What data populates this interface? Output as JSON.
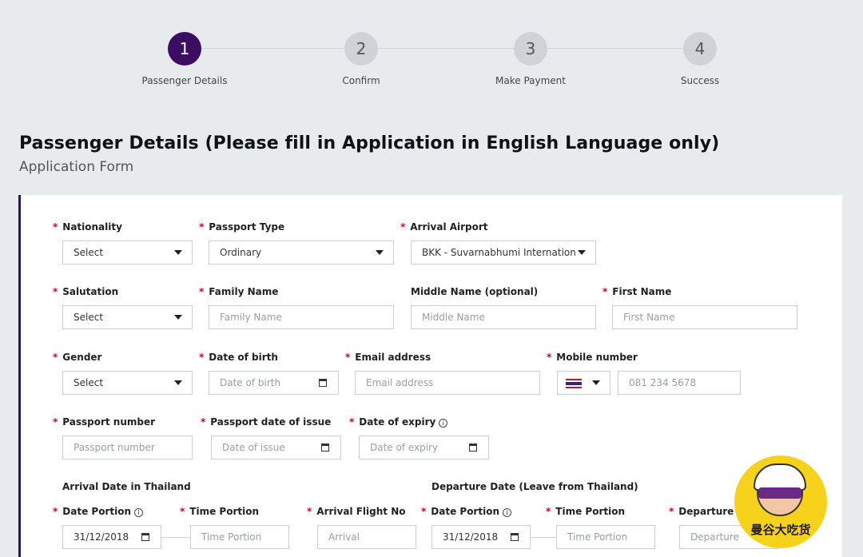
{
  "stepper": {
    "steps": [
      {
        "number": "1",
        "label": "Passenger Details"
      },
      {
        "number": "2",
        "label": "Confirm"
      },
      {
        "number": "3",
        "label": "Make Payment"
      },
      {
        "number": "4",
        "label": "Success"
      }
    ]
  },
  "header": {
    "title": "Passenger Details (Please fill in Application in English Language only)",
    "subtitle": "Application Form"
  },
  "form": {
    "required_mark": "*",
    "info_mark": "i",
    "nationality": {
      "label": "Nationality",
      "value": "Select"
    },
    "passport_type": {
      "label": "Passport Type",
      "value": "Ordinary"
    },
    "arrival_airport": {
      "label": "Arrival Airport",
      "value": "BKK - Suvarnabhumi Internation"
    },
    "salutation": {
      "label": "Salutation",
      "value": "Select"
    },
    "family_name": {
      "label": "Family Name",
      "placeholder": "Family Name"
    },
    "middle_name": {
      "label": "Middle Name (optional)",
      "placeholder": "Middle Name"
    },
    "first_name": {
      "label": "First Name",
      "placeholder": "First Name"
    },
    "gender": {
      "label": "Gender",
      "value": "Select"
    },
    "date_of_birth": {
      "label": "Date of birth",
      "placeholder": "Date of birth"
    },
    "email": {
      "label": "Email address",
      "placeholder": "Email address"
    },
    "mobile": {
      "label": "Mobile number",
      "placeholder": "081 234 5678",
      "country_flag": "thailand-flag"
    },
    "passport_number": {
      "label": "Passport number",
      "placeholder": "Passport number"
    },
    "passport_issue": {
      "label": "Passport date of issue",
      "placeholder": "Date of issue"
    },
    "expiry": {
      "label": "Date of expiry",
      "placeholder": "Date of expiry"
    },
    "arrival": {
      "section_label": "Arrival Date in Thailand",
      "date_label": "Date Portion",
      "date_value": "31/12/2018",
      "time_label": "Time Portion",
      "time_placeholder": "Time Portion",
      "flight_label": "Arrival Flight No",
      "flight_placeholder": "Arrival"
    },
    "departure": {
      "section_label": "Departure Date (Leave from Thailand)",
      "date_label": "Date Portion",
      "date_value": "31/12/2018",
      "time_label": "Time Portion",
      "time_placeholder": "Time Portion",
      "flight_label": "Departure F",
      "flight_placeholder": "Departure"
    }
  },
  "watermark": {
    "text": "曼谷大吃货"
  },
  "colors": {
    "accent": "#3b0d63",
    "required": "#d0021b",
    "badge": "#f7d21b"
  }
}
